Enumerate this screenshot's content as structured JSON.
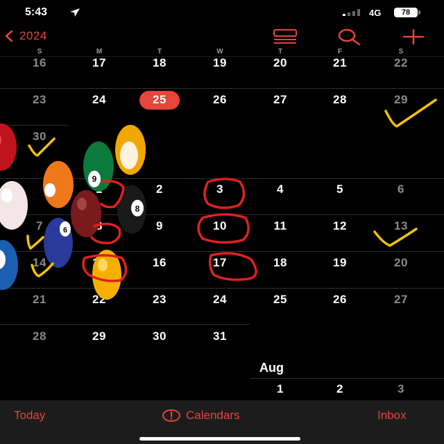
{
  "status_bar": {
    "time": "5:43",
    "network": "4G",
    "battery": "78"
  },
  "nav": {
    "back_label": "2024"
  },
  "weekdays": [
    "S",
    "M",
    "T",
    "W",
    "T",
    "F",
    "S"
  ],
  "calendar": {
    "today": "25",
    "rows": [
      [
        "16",
        "17",
        "18",
        "19",
        "20",
        "21",
        "22"
      ],
      [
        "23",
        "24",
        "25",
        "26",
        "27",
        "28",
        "29"
      ],
      [
        "30",
        "",
        "",
        "",
        "",
        "",
        ""
      ],
      [
        "",
        "1",
        "2",
        "3",
        "4",
        "5",
        "6"
      ],
      [
        "7",
        "8",
        "9",
        "10",
        "11",
        "12",
        "13"
      ],
      [
        "14",
        "15",
        "16",
        "17",
        "18",
        "19",
        "20"
      ],
      [
        "21",
        "22",
        "23",
        "24",
        "25",
        "26",
        "27"
      ],
      [
        "28",
        "29",
        "30",
        "31",
        "",
        "",
        ""
      ]
    ],
    "next_month_label": "Aug",
    "next_month_first_row": [
      "",
      "",
      "",
      "",
      "1",
      "2",
      "3"
    ]
  },
  "toolbar": {
    "today_label": "Today",
    "calendars_label": "Calendars",
    "inbox_label": "Inbox"
  },
  "colors": {
    "accent": "#e7443a",
    "background": "#000000",
    "toolbar": "#1c1c1c",
    "ink_yellow": "#f2c200",
    "ink_red": "#e02020"
  },
  "sticker_ball_numbers": [
    "9",
    "8",
    "6"
  ]
}
